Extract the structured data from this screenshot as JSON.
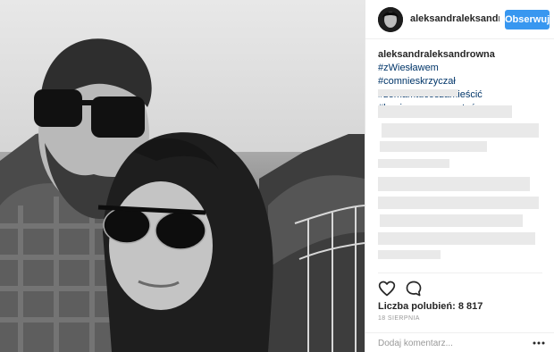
{
  "post": {
    "username": "aleksandraleksandrowna",
    "follow_label": "Obserwuj",
    "caption": {
      "user": "aleksandraleksandrowna",
      "tags": [
        "#zWiesławem",
        "#comnieskrzyczał",
        "#zemamtucośzamieścić",
        "#boniemaczegoczytać"
      ]
    },
    "likes": "Liczba polubień: 8 817",
    "date": "18 SIERPNIA",
    "comment_placeholder": "Dodaj komentarz...",
    "icons": {
      "like": "heart-icon",
      "comment": "comment-bubble-icon",
      "more": "more-options-icon"
    }
  },
  "colors": {
    "follow_button": "#3897f0",
    "hashtag": "#003569",
    "border": "#efefef"
  }
}
